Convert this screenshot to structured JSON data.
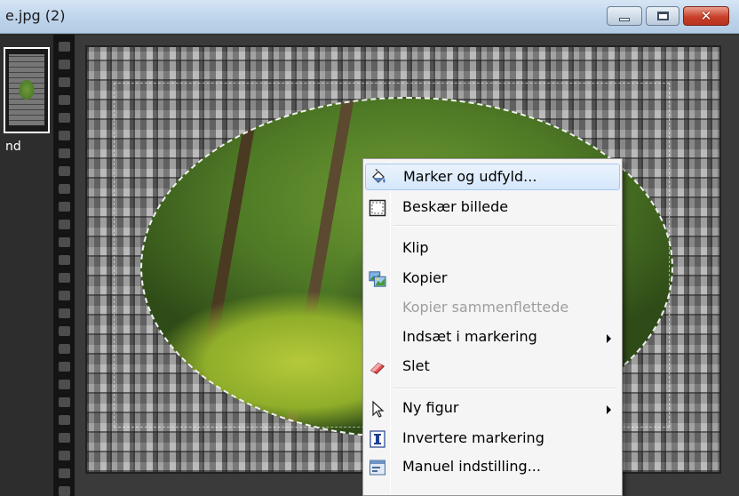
{
  "window": {
    "title": "e.jpg (2)",
    "buttons": {
      "minimize_icon": "minimize-icon",
      "maximize_icon": "maximize-icon",
      "close_icon": "close-icon",
      "close_glyph": "✕"
    }
  },
  "thumbnail_panel": {
    "label": "nd"
  },
  "context_menu": {
    "items": [
      {
        "label": "Marker og udfyld...",
        "icon": "paint-bucket-icon",
        "state": "hover"
      },
      {
        "label": "Beskær billede",
        "icon": "crop-icon"
      },
      {
        "separator": true
      },
      {
        "label": "Klip"
      },
      {
        "label": "Kopier",
        "icon": "copy-pictures-icon"
      },
      {
        "label": "Kopier sammenflettede",
        "state": "disabled"
      },
      {
        "label": "Indsæt i markering",
        "submenu": true
      },
      {
        "label": "Slet",
        "icon": "eraser-icon"
      },
      {
        "separator": true
      },
      {
        "label": "Ny figur",
        "icon": "pointer-icon",
        "submenu": true
      },
      {
        "label": "Invertere markering",
        "icon": "invert-selection-icon"
      },
      {
        "label": "Manuel indstilling...",
        "icon": "manual-setting-icon"
      }
    ]
  }
}
